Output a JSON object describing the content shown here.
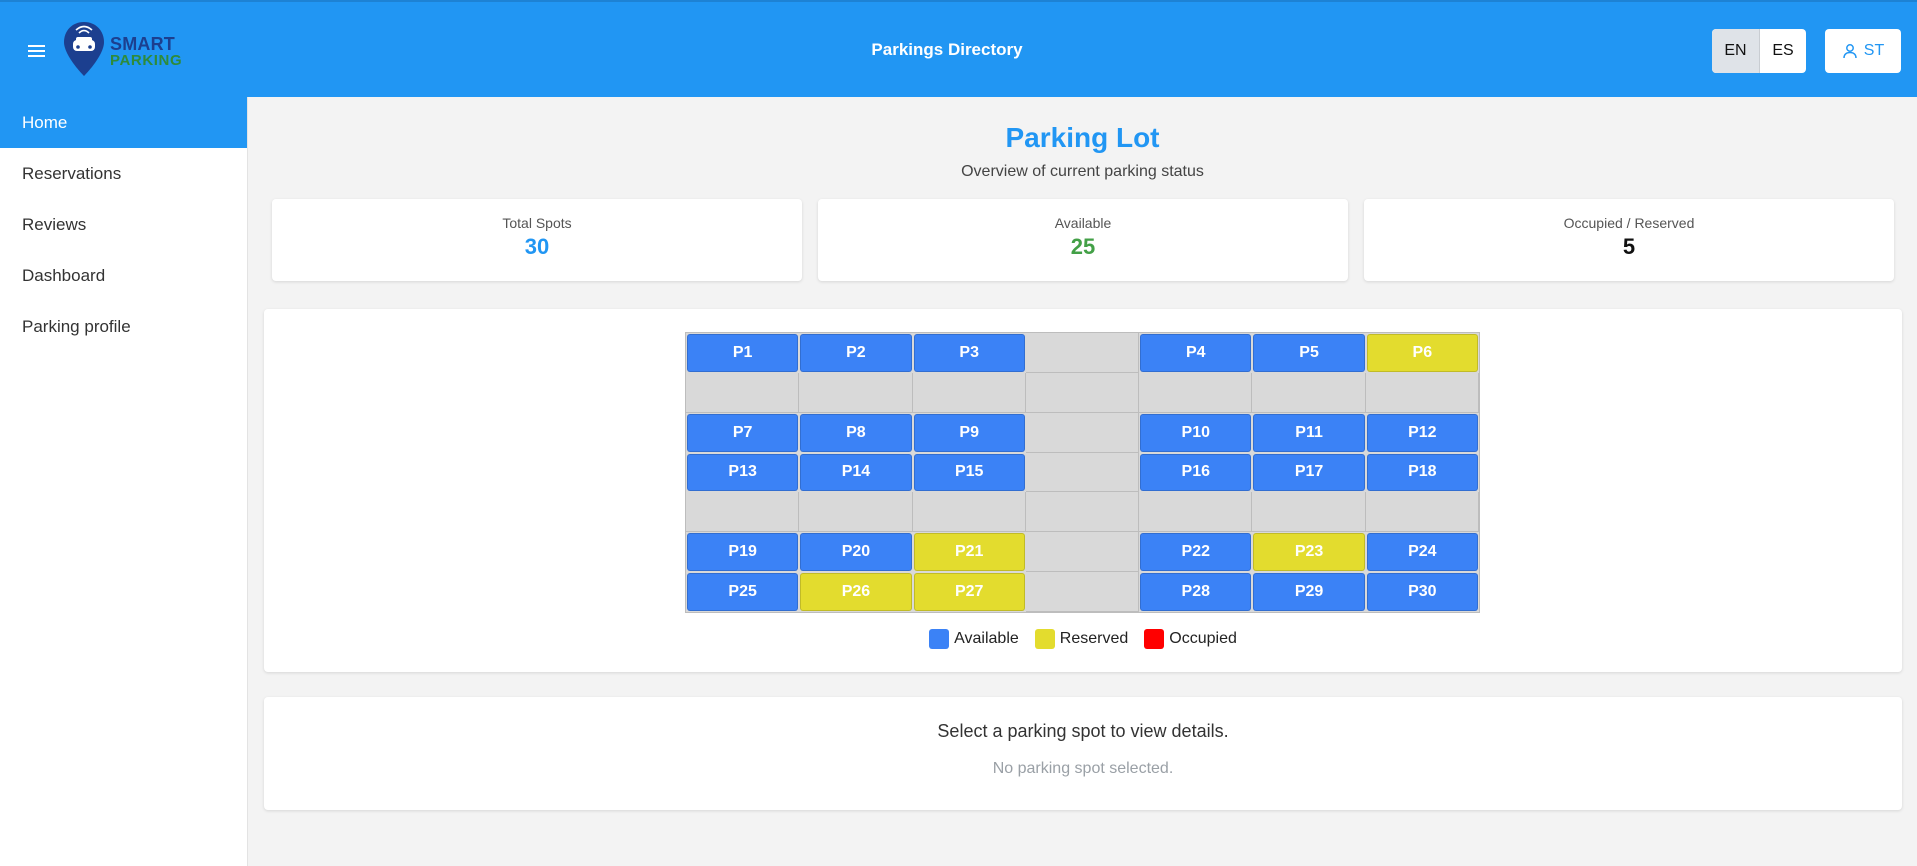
{
  "header": {
    "title": "Parkings Directory",
    "logo_line1": "SMART",
    "logo_line2": "PARKING",
    "languages": [
      "EN",
      "ES"
    ],
    "active_language": "EN",
    "user_initials": "ST"
  },
  "sidebar": {
    "items": [
      {
        "label": "Home",
        "active": true
      },
      {
        "label": "Reservations",
        "active": false
      },
      {
        "label": "Reviews",
        "active": false
      },
      {
        "label": "Dashboard",
        "active": false
      },
      {
        "label": "Parking profile",
        "active": false
      }
    ]
  },
  "page": {
    "title": "Parking Lot",
    "subtitle": "Overview of current parking status"
  },
  "stats": {
    "total_label": "Total Spots",
    "total_value": "30",
    "available_label": "Available",
    "available_value": "25",
    "occupied_label": "Occupied / Reserved",
    "occupied_value": "5"
  },
  "colors": {
    "primary": "#2196f3",
    "available": "#3b82f6",
    "reserved": "#e3dc2e",
    "occupied": "#ff0000",
    "available_stat": "#43a047"
  },
  "lot": {
    "rows": [
      [
        "P1",
        "P2",
        "P3",
        null,
        "P4",
        "P5",
        "P6"
      ],
      [
        null,
        null,
        null,
        null,
        null,
        null,
        null
      ],
      [
        "P7",
        "P8",
        "P9",
        null,
        "P10",
        "P11",
        "P12"
      ],
      [
        "P13",
        "P14",
        "P15",
        null,
        "P16",
        "P17",
        "P18"
      ],
      [
        null,
        null,
        null,
        null,
        null,
        null,
        null
      ],
      [
        "P19",
        "P20",
        "P21",
        null,
        "P22",
        "P23",
        "P24"
      ],
      [
        "P25",
        "P26",
        "P27",
        null,
        "P28",
        "P29",
        "P30"
      ]
    ],
    "reserved": [
      "P6",
      "P21",
      "P23",
      "P26",
      "P27"
    ],
    "occupied": []
  },
  "legend": {
    "available": "Available",
    "reserved": "Reserved",
    "occupied": "Occupied"
  },
  "details": {
    "prompt": "Select a parking spot to view details.",
    "empty": "No parking spot selected."
  }
}
